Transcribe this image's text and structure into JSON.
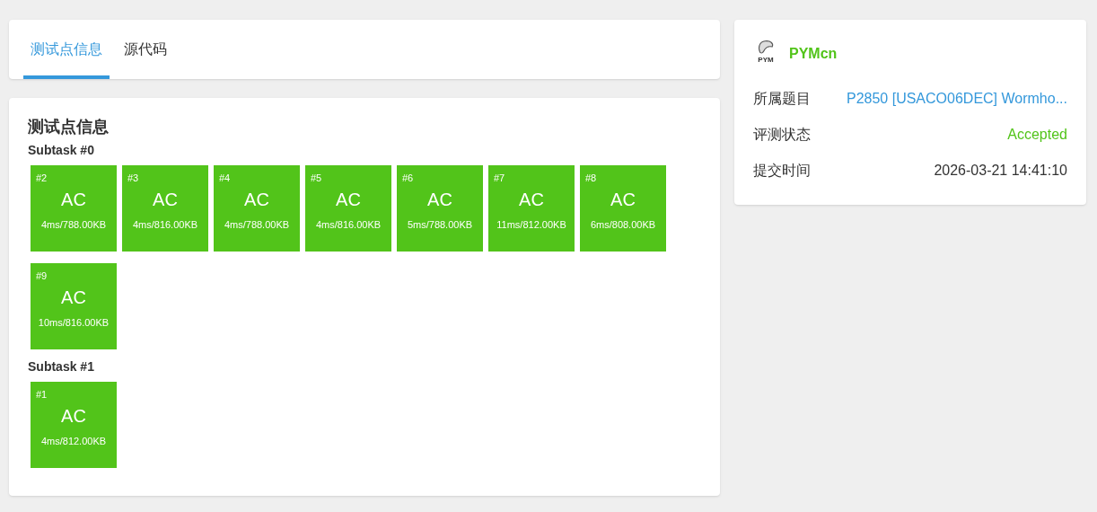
{
  "tabs": [
    {
      "label": "测试点信息",
      "selected": true
    },
    {
      "label": "源代码",
      "selected": false
    }
  ],
  "testcases": {
    "title": "测试点信息",
    "subtasks": [
      {
        "title": "Subtask #0",
        "cases": [
          {
            "id": "#2",
            "result": "AC",
            "detail": "4ms/788.00KB"
          },
          {
            "id": "#3",
            "result": "AC",
            "detail": "4ms/816.00KB"
          },
          {
            "id": "#4",
            "result": "AC",
            "detail": "4ms/788.00KB"
          },
          {
            "id": "#5",
            "result": "AC",
            "detail": "4ms/816.00KB"
          },
          {
            "id": "#6",
            "result": "AC",
            "detail": "5ms/788.00KB"
          },
          {
            "id": "#7",
            "result": "AC",
            "detail": "11ms/812.00KB"
          },
          {
            "id": "#8",
            "result": "AC",
            "detail": "6ms/808.00KB"
          },
          {
            "id": "#9",
            "result": "AC",
            "detail": "10ms/816.00KB"
          }
        ]
      },
      {
        "title": "Subtask #1",
        "cases": [
          {
            "id": "#1",
            "result": "AC",
            "detail": "4ms/812.00KB"
          }
        ]
      }
    ]
  },
  "info": {
    "user": "PYMcn",
    "avatar_caption": "PYM",
    "rows": [
      {
        "label": "所属题目",
        "value": "P2850 [USACO06DEC] Wormho...",
        "kind": "link"
      },
      {
        "label": "评测状态",
        "value": "Accepted",
        "kind": "status"
      },
      {
        "label": "提交时间",
        "value": "2026-03-21 14:41:10",
        "kind": "plain"
      }
    ]
  }
}
